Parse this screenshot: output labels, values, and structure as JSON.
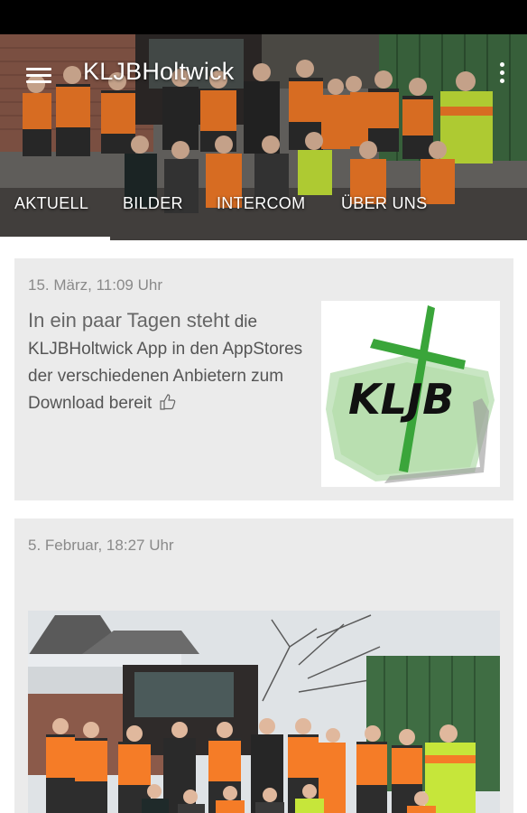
{
  "app": {
    "title": "KLJBHoltwick"
  },
  "tabs": [
    {
      "label": "AKTUELL",
      "selected": true
    },
    {
      "label": "BILDER",
      "selected": false
    },
    {
      "label": "INTERCOM",
      "selected": false
    },
    {
      "label": "ÜBER UNS",
      "selected": false
    }
  ],
  "posts": [
    {
      "date": "15. März, 11:09 Uhr",
      "text_lead": "In ein paar Tagen steht",
      "text_rest": " die KLJBHoltwick App in den AppStores der verschiedenen Anbietern zum Download bereit",
      "emoji_icon": "thumbs-up-icon",
      "thumbnail_logo_text": "KLJB"
    },
    {
      "date": "5. Februar, 18:27 Uhr"
    }
  ],
  "colors": {
    "status_bar": "#000000",
    "card_background": "#ebebeb",
    "date_text": "#8a8a8a",
    "vest_orange": "#f57c27",
    "vest_yellow": "#c6e63a",
    "logo_green": "#3aa53a"
  }
}
